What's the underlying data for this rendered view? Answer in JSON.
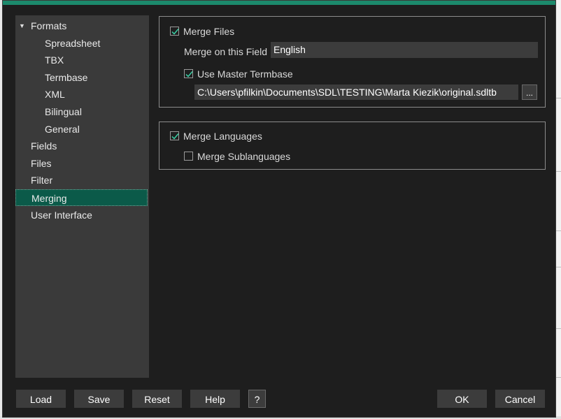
{
  "tree": {
    "items": [
      {
        "label": "Formats",
        "level": 0,
        "expanded": true
      },
      {
        "label": "Spreadsheet",
        "level": 1
      },
      {
        "label": "TBX",
        "level": 1
      },
      {
        "label": "Termbase",
        "level": 1
      },
      {
        "label": "XML",
        "level": 1
      },
      {
        "label": "Bilingual",
        "level": 1
      },
      {
        "label": "General",
        "level": 1
      },
      {
        "label": "Fields",
        "level": 0
      },
      {
        "label": "Files",
        "level": 0
      },
      {
        "label": "Filter",
        "level": 0
      },
      {
        "label": "Merging",
        "level": 0,
        "selected": true
      },
      {
        "label": "User Interface",
        "level": 0
      }
    ]
  },
  "merge_files": {
    "label": "Merge Files",
    "checked": true,
    "field_label": "Merge on this Field",
    "field_value": "English",
    "use_master_label": "Use Master Termbase",
    "use_master_checked": true,
    "path_value": "C:\\Users\\pfilkin\\Documents\\SDL\\TESTING\\Marta Kiezik\\original.sdltb",
    "browse_label": "..."
  },
  "merge_languages": {
    "label": "Merge Languages",
    "checked": true,
    "sub_label": "Merge Sublanguages",
    "sub_checked": false
  },
  "buttons": {
    "load": "Load",
    "save": "Save",
    "reset": "Reset",
    "help": "Help",
    "question": "?",
    "ok": "OK",
    "cancel": "Cancel"
  },
  "colors": {
    "accent": "#1c8a6c",
    "selected": "#0b5a49",
    "background": "#1e1e1e",
    "panel": "#3a3a3a"
  }
}
